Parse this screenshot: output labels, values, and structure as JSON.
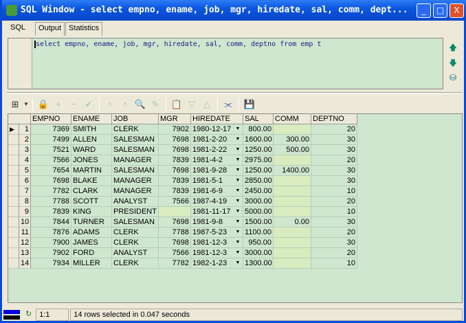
{
  "window": {
    "title": "SQL Window - select empno, ename, job, mgr, hiredate, sal, comm, dept...",
    "minimize": "_",
    "maximize": "□",
    "close": "X"
  },
  "tabs": [
    "SQL",
    "Output",
    "Statistics"
  ],
  "editor": {
    "sql": "select empno, ename, job, mgr, hiredate, sal, comm, deptno from emp t"
  },
  "side_icons": [
    "arrow-up-icon",
    "arrow-down-icon",
    "database-icon"
  ],
  "grid": {
    "columns": [
      "EMPNO",
      "ENAME",
      "JOB",
      "MGR",
      "HIREDATE",
      "SAL",
      "COMM",
      "DEPTNO"
    ],
    "rows": [
      [
        "7369",
        "SMITH",
        "CLERK",
        "7902",
        "1980-12-17",
        "800.00",
        "",
        "20"
      ],
      [
        "7499",
        "ALLEN",
        "SALESMAN",
        "7698",
        "1981-2-20",
        "1600.00",
        "300.00",
        "30"
      ],
      [
        "7521",
        "WARD",
        "SALESMAN",
        "7698",
        "1981-2-22",
        "1250.00",
        "500.00",
        "30"
      ],
      [
        "7566",
        "JONES",
        "MANAGER",
        "7839",
        "1981-4-2",
        "2975.00",
        "",
        "20"
      ],
      [
        "7654",
        "MARTIN",
        "SALESMAN",
        "7698",
        "1981-9-28",
        "1250.00",
        "1400.00",
        "30"
      ],
      [
        "7698",
        "BLAKE",
        "MANAGER",
        "7839",
        "1981-5-1",
        "2850.00",
        "",
        "30"
      ],
      [
        "7782",
        "CLARK",
        "MANAGER",
        "7839",
        "1981-6-9",
        "2450.00",
        "",
        "10"
      ],
      [
        "7788",
        "SCOTT",
        "ANALYST",
        "7566",
        "1987-4-19",
        "3000.00",
        "",
        "20"
      ],
      [
        "7839",
        "KING",
        "PRESIDENT",
        "",
        "1981-11-17",
        "5000.00",
        "",
        "10"
      ],
      [
        "7844",
        "TURNER",
        "SALESMAN",
        "7698",
        "1981-9-8",
        "1500.00",
        "0.00",
        "30"
      ],
      [
        "7876",
        "ADAMS",
        "CLERK",
        "7788",
        "1987-5-23",
        "1100.00",
        "",
        "20"
      ],
      [
        "7900",
        "JAMES",
        "CLERK",
        "7698",
        "1981-12-3",
        "950.00",
        "",
        "30"
      ],
      [
        "7902",
        "FORD",
        "ANALYST",
        "7566",
        "1981-12-3",
        "3000.00",
        "",
        "20"
      ],
      [
        "7934",
        "MILLER",
        "CLERK",
        "7782",
        "1982-1-23",
        "1300.00",
        "",
        "10"
      ]
    ]
  },
  "status": {
    "position": "1:1",
    "message": "14 rows selected in 0.047 seconds"
  }
}
